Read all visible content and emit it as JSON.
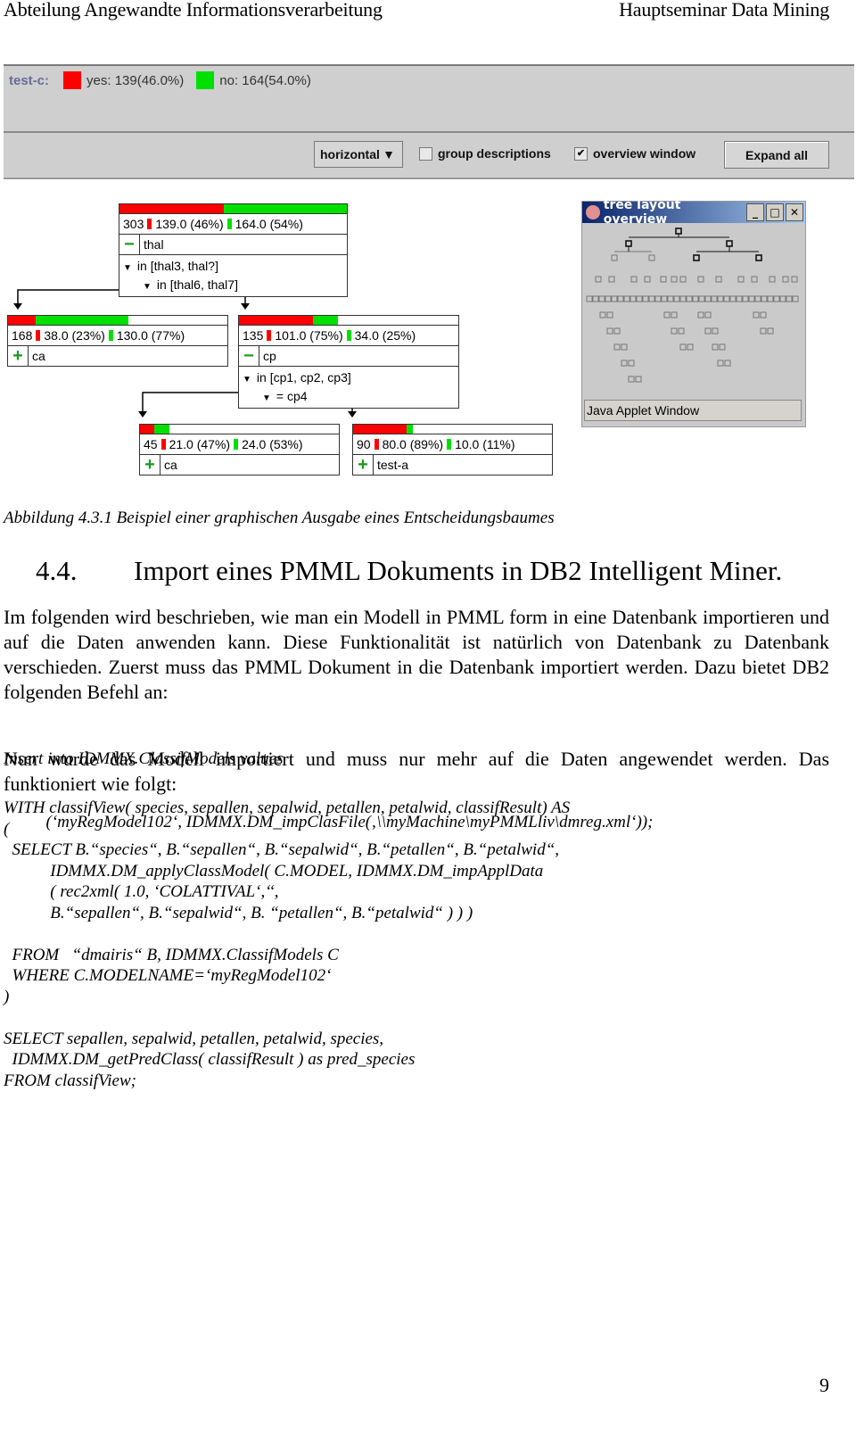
{
  "header": {
    "left": "Abteilung Angewandte Informationsverarbeitung",
    "right": "Hauptseminar Data Mining"
  },
  "applet": {
    "legend": {
      "label": "test-c:",
      "items": [
        {
          "text": "yes: 139(46.0%)",
          "color": "#ff0000"
        },
        {
          "text": "no: 164(54.0%)",
          "color": "#00e000"
        }
      ]
    },
    "toolbar": {
      "orientation_select": "horizontal",
      "group_descriptions": {
        "label": "group descriptions",
        "checked": false
      },
      "overview_window": {
        "label": "overview window",
        "checked": true,
        "mark": "✔"
      },
      "expand_all": "Expand all"
    },
    "colors": {
      "yes": "#ff0000",
      "no": "#00e000"
    },
    "nodes": [
      {
        "id": "root",
        "yes_frac": 0.46,
        "fill": 1.0,
        "stats": {
          "n": "303",
          "yes": "139.0 (46%)",
          "no": "164.0 (54%)"
        },
        "toggle": "−",
        "attr": "thal",
        "conds": [
          "in [thal3, thal?]",
          "in [thal6, thal7]"
        ]
      },
      {
        "id": "left",
        "yes_frac": 0.23,
        "fill": 0.55,
        "stats": {
          "n": "168",
          "yes": "38.0 (23%)",
          "no": "130.0 (77%)"
        },
        "toggle": "+",
        "attr": "ca",
        "conds": []
      },
      {
        "id": "right",
        "yes_frac": 0.75,
        "fill": 0.45,
        "stats": {
          "n": "135",
          "yes": "101.0 (75%)",
          "no": "34.0 (25%)"
        },
        "toggle": "−",
        "attr": "cp",
        "conds": [
          "in [cp1, cp2, cp3]",
          "= cp4"
        ]
      },
      {
        "id": "rl",
        "yes_frac": 0.47,
        "fill": 0.15,
        "stats": {
          "n": "45",
          "yes": "21.0 (47%)",
          "no": "24.0 (53%)"
        },
        "toggle": "+",
        "attr": "ca",
        "conds": []
      },
      {
        "id": "rr",
        "yes_frac": 0.89,
        "fill": 0.3,
        "stats": {
          "n": "90",
          "yes": "80.0 (89%)",
          "no": "10.0 (11%)"
        },
        "toggle": "+",
        "attr": "test-a",
        "conds": []
      }
    ],
    "overview": {
      "title": "tree layout overview",
      "buttons": [
        "_",
        "□",
        "✕"
      ],
      "status": "Java Applet Window"
    }
  },
  "caption": "Abbildung 4.3.1 Beispiel einer graphischen Ausgabe eines Entscheidungsbaumes",
  "section": {
    "number": "4.4.",
    "title": "Import eines PMML Dokuments in DB2 Intelligent Miner."
  },
  "paragraphs": [
    "Im folgenden wird beschrieben, wie man ein Modell in PMML form in eine Datenbank importieren und auf die Daten anwenden kann. Diese Funktionalität ist natürlich von Datenbank zu Datenbank verschieden. Zuerst muss das PMML Dokument in die Datenbank importiert werden. Dazu bietet DB2 folgenden Befehl an:",
    "Nun wurde das Modell importiert und muss nur mehr auf die Daten angewendet werden. Das funktioniert wie folgt:"
  ],
  "code1": [
    "Insert into IDMMX.ClassifModels values",
    "          (‘myRegModel102‘, IDMMX.DM_impClasFile(‚\\\\myMachine\\myPMMLliv\\dmreg.xml‘));"
  ],
  "code2": [
    "WITH classifView( species, sepallen, sepalwid, petallen, petalwid, classifResult) AS",
    "(",
    "  SELECT B.“species“, B.“sepallen“, B.“sepalwid“, B.“petallen“, B.“petalwid“,",
    "           IDMMX.DM_applyClassModel( C.MODEL, IDMMX.DM_impApplData",
    "           ( rec2xml( 1.0, ‘COLATTIVAL‘,‘‘,",
    "           B.“sepallen“, B.“sepalwid“, B. “petallen“, B.“petalwid“ ) ) )",
    "",
    "  FROM   “dmairis“ B, IDMMX.ClassifModels C",
    "  WHERE C.MODELNAME=‘myRegModel102‘",
    ")",
    "",
    "SELECT sepallen, sepalwid, petallen, petalwid, species,",
    "  IDMMX.DM_getPredClass( classifResult ) as pred_species",
    "FROM classifView;"
  ],
  "page_number": "9"
}
